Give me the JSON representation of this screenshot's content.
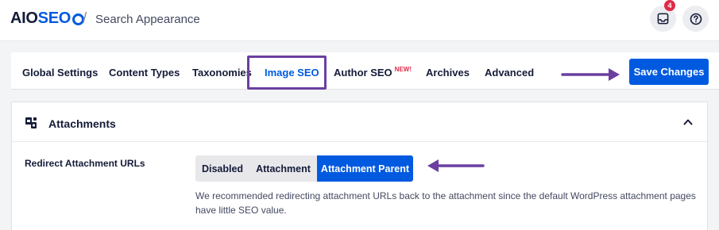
{
  "header": {
    "logo_text_aio": "AIO",
    "logo_text_seo": "SEO",
    "separator": "/",
    "page_title": "Search Appearance",
    "notification_count": "4",
    "inbox_icon": "inbox-icon",
    "help_icon": "help-icon"
  },
  "tabs": [
    {
      "label": "Global Settings",
      "active": false
    },
    {
      "label": "Content Types",
      "active": false
    },
    {
      "label": "Taxonomies",
      "active": false
    },
    {
      "label": "Image SEO",
      "active": true
    },
    {
      "label": "Author SEO",
      "active": false,
      "tag": "NEW!"
    },
    {
      "label": "Archives",
      "active": false
    },
    {
      "label": "Advanced",
      "active": false
    }
  ],
  "toolbar": {
    "save_label": "Save Changes"
  },
  "card": {
    "title": "Attachments",
    "icon": "attachments-icon",
    "collapse_icon": "chevron-up-icon",
    "setting": {
      "label": "Redirect Attachment URLs",
      "options": [
        "Disabled",
        "Attachment",
        "Attachment Parent"
      ],
      "selected": "Attachment Parent",
      "description": "We recommended redirecting attachment URLs back to the attachment since the default WordPress attachment pages have little SEO value."
    }
  },
  "colors": {
    "accent": "#005ae0",
    "annotation": "#6b3fa0",
    "badge": "#df2a4a"
  }
}
